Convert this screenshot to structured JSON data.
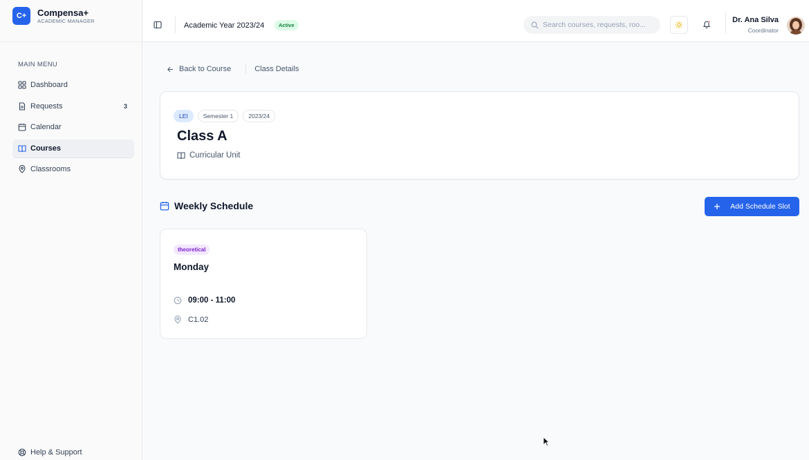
{
  "brand": {
    "logo": "C+",
    "name": "Compensa+",
    "subtitle": "ACADEMIC MANAGER"
  },
  "sidebar": {
    "menu_title": "MAIN MENU",
    "items": [
      {
        "label": "Dashboard",
        "icon": "dashboard-icon"
      },
      {
        "label": "Requests",
        "icon": "document-icon",
        "badge": "3"
      },
      {
        "label": "Calendar",
        "icon": "calendar-icon"
      },
      {
        "label": "Courses",
        "icon": "book-icon",
        "active": true
      },
      {
        "label": "Classrooms",
        "icon": "map-pin-icon"
      }
    ],
    "help_label": "Help & Support"
  },
  "header": {
    "academic_year": "Academic Year 2023/24",
    "status_badge": "Active",
    "search_placeholder": "Search courses, requests, roo...",
    "user_name": "Dr. Ana Silva",
    "user_role": "Coordinator"
  },
  "breadcrumb": {
    "back": "Back to Course",
    "current": "Class Details"
  },
  "class_card": {
    "tags": [
      "LEI",
      "Semester 1",
      "2023/24"
    ],
    "title": "Class A",
    "subtitle": "Curricular Unit"
  },
  "schedule": {
    "title": "Weekly Schedule",
    "add_button": "Add Schedule Slot",
    "slots": [
      {
        "type": "theoretical",
        "day": "Monday",
        "time": "09:00 - 11:00",
        "room": "C1.02"
      }
    ]
  },
  "colors": {
    "accent": "#2563eb",
    "active_badge_bg": "#dcfce7",
    "active_badge_text": "#15803d",
    "slot_type_bg": "#f3e8ff",
    "slot_type_text": "#7e22ce",
    "code_tag_bg": "#dbeafe"
  }
}
